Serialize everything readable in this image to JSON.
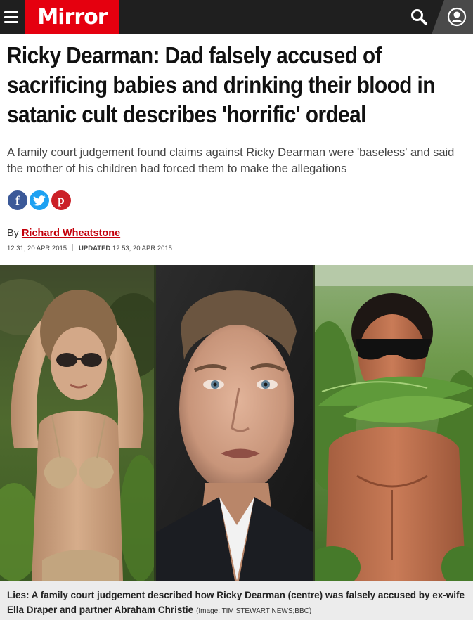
{
  "header": {
    "logo": "Mirror",
    "icons": [
      "menu-icon",
      "search-icon",
      "account-icon"
    ],
    "brand_color": "#e5000f",
    "bar_color": "#1f1f1f"
  },
  "article": {
    "headline": "Ricky Dearman: Dad falsely accused of sacrificing babies and drinking their blood in satanic cult describes 'horrific' ordeal",
    "standfirst": "A family court judgement found claims against Ricky Dearman were 'baseless' and said the mother of his children had forced them to make the allegations",
    "share": {
      "facebook": "f",
      "twitter": "twitter-bird",
      "pinterest": "p"
    },
    "byline_prefix": "By",
    "author": "Richard Wheatstone",
    "published": "12:31, 20 APR 2015",
    "updated_label": "UPDATED",
    "updated": "12:53, 20 APR 2015",
    "caption": "Lies: A family court judgement described how Ricky Dearman (centre) was falsely accused by ex-wife Ella Draper and partner Abraham Christie",
    "credit": "(Image: TIM STEWART NEWS;BBC)"
  }
}
